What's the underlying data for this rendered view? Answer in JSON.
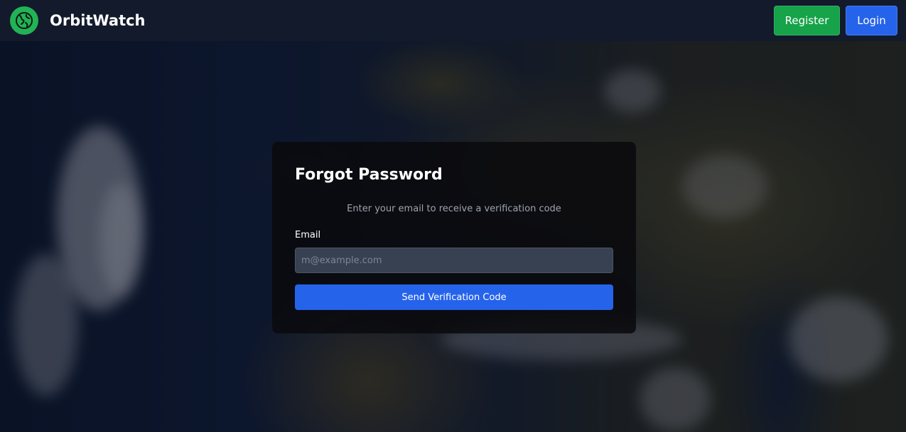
{
  "brand": {
    "name": "OrbitWatch",
    "logo_icon": "globe-icon",
    "accent": "#22b357"
  },
  "nav": {
    "register_label": "Register",
    "login_label": "Login",
    "register_color": "#16a34a",
    "login_color": "#2563eb"
  },
  "background": {
    "image": "satellite-earth-map"
  },
  "form": {
    "title": "Forgot Password",
    "subtitle": "Enter your email to receive a verification code",
    "email_label": "Email",
    "email_placeholder": "m@example.com",
    "email_value": "",
    "submit_label": "Send Verification Code"
  }
}
